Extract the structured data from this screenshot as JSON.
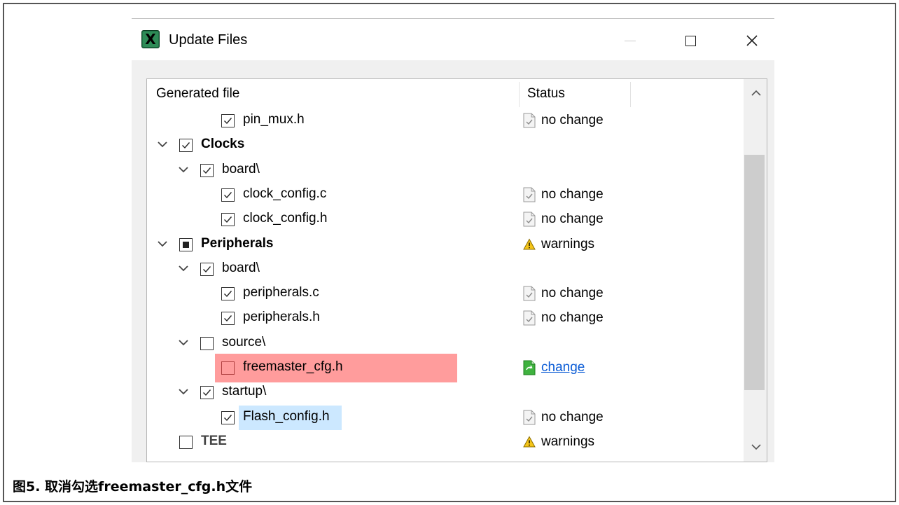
{
  "window": {
    "title": "Update Files",
    "app_icon_letter": "X"
  },
  "tree": {
    "headers": {
      "generated_file": "Generated file",
      "status": "Status"
    },
    "rows": [
      {
        "label": "pin_mux.h",
        "level": 3,
        "expand": false,
        "checkbox": "checked",
        "bold": false,
        "status": "no change",
        "status_icon": "file-unchanged-icon"
      },
      {
        "label": "Clocks",
        "level": 1,
        "expand": true,
        "checkbox": "checked",
        "bold": true,
        "status": "",
        "status_icon": ""
      },
      {
        "label": "board\\",
        "level": 2,
        "expand": true,
        "checkbox": "checked",
        "bold": false,
        "status": "",
        "status_icon": ""
      },
      {
        "label": "clock_config.c",
        "level": 3,
        "expand": false,
        "checkbox": "checked",
        "bold": false,
        "status": "no change",
        "status_icon": "file-unchanged-icon"
      },
      {
        "label": "clock_config.h",
        "level": 3,
        "expand": false,
        "checkbox": "checked",
        "bold": false,
        "status": "no change",
        "status_icon": "file-unchanged-icon"
      },
      {
        "label": "Peripherals",
        "level": 1,
        "expand": true,
        "checkbox": "partial",
        "bold": true,
        "status": "warnings",
        "status_icon": "warning-icon"
      },
      {
        "label": "board\\",
        "level": 2,
        "expand": true,
        "checkbox": "checked",
        "bold": false,
        "status": "",
        "status_icon": ""
      },
      {
        "label": "peripherals.c",
        "level": 3,
        "expand": false,
        "checkbox": "checked",
        "bold": false,
        "status": "no change",
        "status_icon": "file-unchanged-icon"
      },
      {
        "label": "peripherals.h",
        "level": 3,
        "expand": false,
        "checkbox": "checked",
        "bold": false,
        "status": "no change",
        "status_icon": "file-unchanged-icon"
      },
      {
        "label": "source\\",
        "level": 2,
        "expand": true,
        "checkbox": "unchecked",
        "bold": false,
        "status": "",
        "status_icon": ""
      },
      {
        "label": "freemaster_cfg.h",
        "level": 3,
        "expand": false,
        "checkbox": "unchecked",
        "bold": false,
        "status": "change",
        "status_icon": "file-changed-icon",
        "highlight": "red",
        "status_link": true
      },
      {
        "label": "startup\\",
        "level": 2,
        "expand": true,
        "checkbox": "checked",
        "bold": false,
        "status": "",
        "status_icon": ""
      },
      {
        "label": "Flash_config.h",
        "level": 3,
        "expand": false,
        "checkbox": "checked",
        "bold": false,
        "status": "no change",
        "status_icon": "file-unchanged-icon",
        "highlight": "blue"
      },
      {
        "label": "TEE",
        "level": 1,
        "expand": false,
        "checkbox": "unchecked",
        "bold": true,
        "status": "warnings",
        "status_icon": "warning-icon",
        "dim": true
      }
    ]
  },
  "caption": "图5. 取消勾选freemaster_cfg.h文件",
  "colors": {
    "highlight_red": "#ff9c9c",
    "highlight_blue": "#cce8ff",
    "link": "#0b5cd6",
    "changed_icon": "#3fb23f"
  }
}
